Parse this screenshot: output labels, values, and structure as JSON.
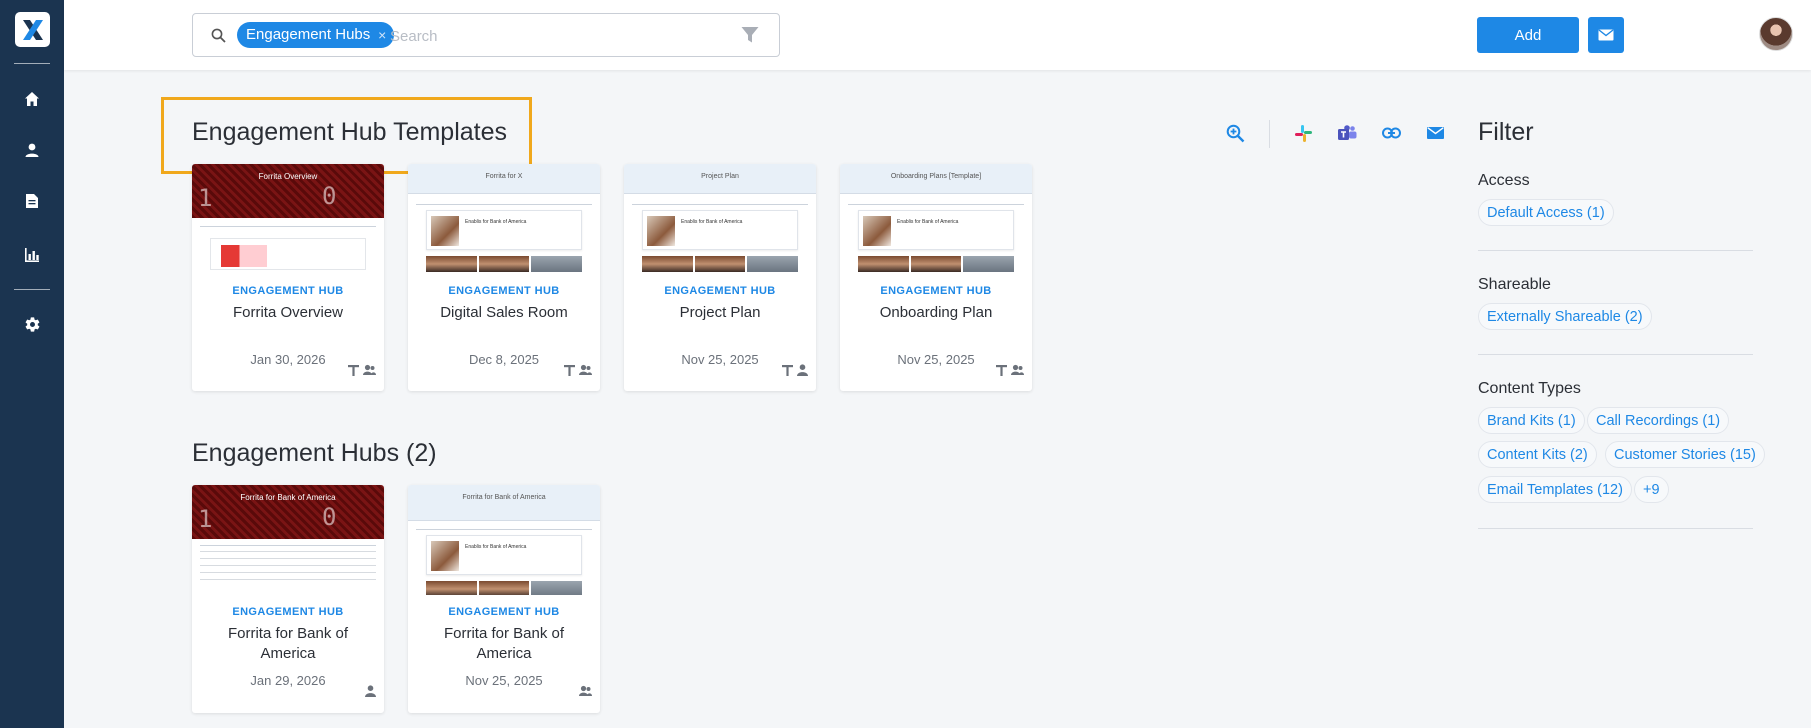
{
  "search": {
    "chip_label": "Engagement Hubs",
    "chip_remove": "×",
    "placeholder": "Search"
  },
  "header": {
    "add_label": "Add"
  },
  "sections": {
    "templates_title": "Engagement Hub Templates",
    "hubs_title": "Engagement Hubs (2)"
  },
  "templates": [
    {
      "tag": "ENGAGEMENT HUB",
      "title": "Forrita Overview",
      "date": "Jan 30, 2026",
      "thumb_title": "Forrita Overview",
      "icons": [
        "template-icon",
        "group-icon"
      ]
    },
    {
      "tag": "ENGAGEMENT HUB",
      "title": "Digital Sales Room",
      "date": "Dec 8, 2025",
      "thumb_title": "Forrita for X",
      "icons": [
        "template-icon",
        "group-icon"
      ]
    },
    {
      "tag": "ENGAGEMENT HUB",
      "title": "Project Plan",
      "date": "Nov 25, 2025",
      "thumb_title": "Project Plan",
      "icons": [
        "template-icon",
        "person-icon"
      ]
    },
    {
      "tag": "ENGAGEMENT HUB",
      "title": "Onboarding Plan",
      "date": "Nov 25, 2025",
      "thumb_title": "Onboarding Plans [Template]",
      "icons": [
        "template-icon",
        "group-icon"
      ]
    }
  ],
  "hubs": [
    {
      "tag": "ENGAGEMENT HUB",
      "title": "Forrita for Bank of America",
      "date": "Jan 29, 2026",
      "thumb_title": "Forrita for Bank of America",
      "icons": [
        "person-icon"
      ]
    },
    {
      "tag": "ENGAGEMENT HUB",
      "title": "Forrita for Bank of America",
      "date": "Nov 25, 2025",
      "thumb_title": "Forrita for Bank of America",
      "icons": [
        "group-icon"
      ]
    }
  ],
  "filter": {
    "title": "Filter",
    "access": {
      "label": "Access",
      "pills": [
        "Default Access (1)"
      ]
    },
    "shareable": {
      "label": "Shareable",
      "pills": [
        "Externally Shareable (2)"
      ]
    },
    "content_types": {
      "label": "Content Types",
      "pills": [
        "Brand Kits (1)",
        "Call Recordings (1)",
        "Content Kits (2)",
        "Customer Stories (15)",
        "Email Templates (12)",
        "+9"
      ]
    }
  },
  "colors": {
    "sidebar": "#1b3450",
    "accent": "#1e88e5",
    "highlight": "#f0a81c"
  }
}
